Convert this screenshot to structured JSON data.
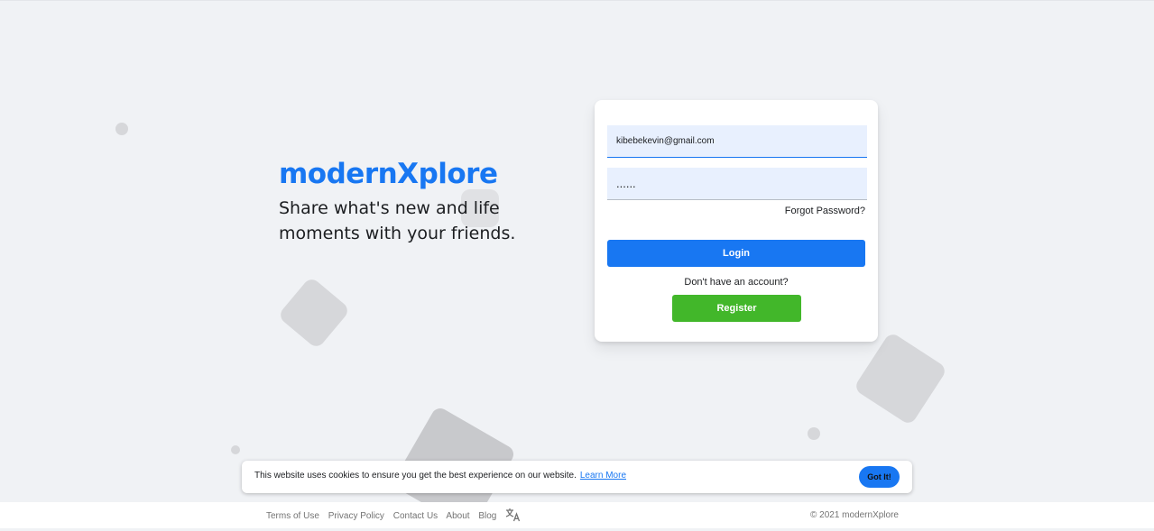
{
  "brand": {
    "logo": "modernXplore",
    "tagline": "Share what's new and life moments with your friends."
  },
  "login_form": {
    "email_value": "kibebekevin@gmail.com",
    "password_value": "......",
    "forgot_password": "Forgot Password?",
    "login_button": "Login",
    "no_account_text": "Don't have an account?",
    "register_button": "Register"
  },
  "cookie_banner": {
    "message": "This website uses cookies to ensure you get the best experience on our website.",
    "learn_more": "Learn More",
    "accept_button": "Got It!"
  },
  "footer": {
    "links": [
      "Terms of Use",
      "Privacy Policy",
      "Contact Us",
      "About",
      "Blog"
    ],
    "language_icon": "translate-icon",
    "copyright": "© 2021 modernXplore"
  },
  "colors": {
    "brand_blue": "#1877f2",
    "register_green": "#42b72a",
    "background": "#f0f2f5"
  }
}
